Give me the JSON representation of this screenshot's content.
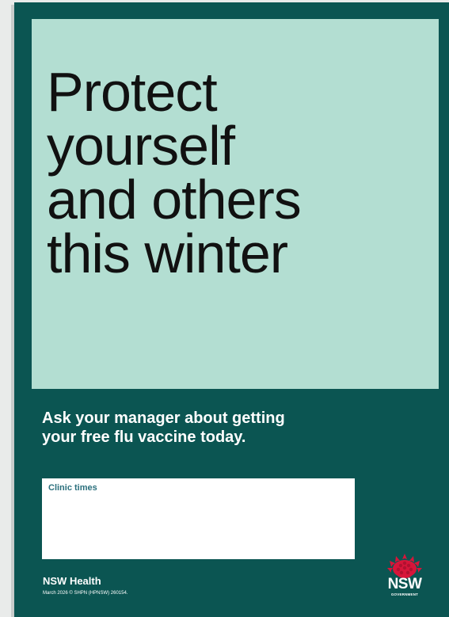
{
  "colors": {
    "background": "#0b5552",
    "headline_panel": "#b3ded2",
    "clinic_label": "#2a6f7c",
    "logo_red": "#d7153a"
  },
  "headline": {
    "lines": [
      "Protect",
      "yourself",
      "and others",
      "this winter"
    ]
  },
  "callout": {
    "lines": [
      "Ask your manager about getting",
      "your free flu vaccine today."
    ]
  },
  "clinic_box": {
    "label": "Clinic times"
  },
  "footer": {
    "brand": "NSW Health",
    "footnote": "March 2026 © SHPN (HPNSW) 260154."
  },
  "logo": {
    "icon": "waratah-icon",
    "text": "NSW",
    "subtext": "GOVERNMENT"
  }
}
